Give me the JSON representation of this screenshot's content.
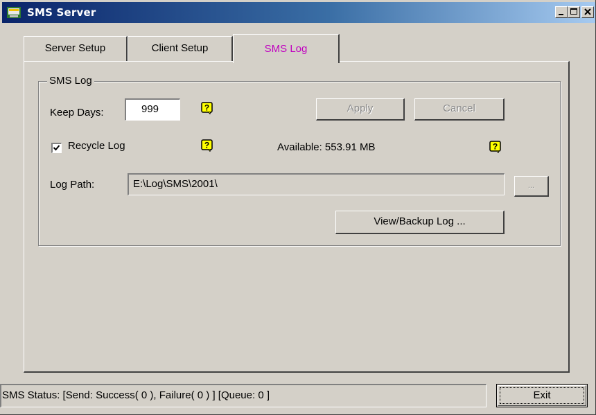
{
  "window": {
    "title": "SMS Server",
    "controls": [
      "minimize-icon",
      "maximize-icon",
      "close-icon"
    ]
  },
  "tabs": [
    {
      "label": "Server Setup",
      "active": false
    },
    {
      "label": "Client Setup",
      "active": false
    },
    {
      "label": "SMS Log",
      "active": true
    }
  ],
  "smslog": {
    "group_title": "SMS Log",
    "keep_days_label": "Keep Days:",
    "keep_days_value": "999",
    "apply_label": "Apply",
    "cancel_label": "Cancel",
    "recycle_label": "Recycle Log",
    "recycle_checked": true,
    "available_label": "Available: 553.91 MB",
    "log_path_label": "Log Path:",
    "log_path_value": "E:\\Log\\SMS\\2001\\",
    "browse_label": "...",
    "view_backup_label": "View/Backup Log ..."
  },
  "status": {
    "text": "SMS Status: [Send: Success( 0 ), Failure( 0 ) ] [Queue: 0 ]"
  },
  "exit_label": "Exit",
  "colors": {
    "active_tab_text": "#c000c0",
    "help_icon_bg": "#ffff00",
    "face": "#d4d0c8",
    "title_start": "#0a246a",
    "title_end": "#a6caf0"
  }
}
